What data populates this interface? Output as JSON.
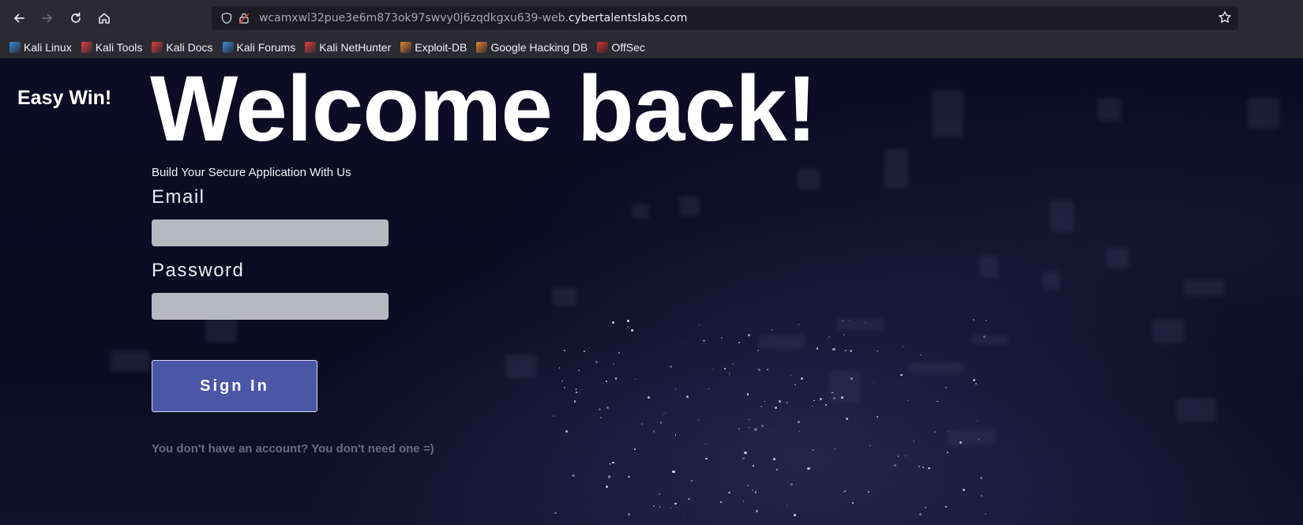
{
  "browser": {
    "url_prefix": "wcamxwl32pue3e6m873ok97swvy0j6zqdkgxu639-web.",
    "url_domain": "cybertalentslabs.com",
    "icons": {
      "back": "back-arrow-icon",
      "forward": "forward-arrow-icon",
      "reload": "reload-icon",
      "home": "home-icon",
      "shield": "tracking-shield-icon",
      "lock": "lock-icon",
      "star": "bookmark-star-icon"
    },
    "bookmarks": [
      {
        "label": "Kali Linux",
        "icon": "kali-dragon-icon",
        "color": "#3b8ed8"
      },
      {
        "label": "Kali Tools",
        "icon": "kali-tools-icon",
        "color": "#e64040"
      },
      {
        "label": "Kali Docs",
        "icon": "kali-docs-icon",
        "color": "#e33b3b"
      },
      {
        "label": "Kali Forums",
        "icon": "kali-forums-icon",
        "color": "#3b8ed8"
      },
      {
        "label": "Kali NetHunter",
        "icon": "kali-nethunter-icon",
        "color": "#e33b3b"
      },
      {
        "label": "Exploit-DB",
        "icon": "exploit-db-icon",
        "color": "#e8852c"
      },
      {
        "label": "Google Hacking DB",
        "icon": "ghdb-icon",
        "color": "#e8852c"
      },
      {
        "label": "OffSec",
        "icon": "offsec-icon",
        "color": "#d42a2a"
      }
    ]
  },
  "page": {
    "brand": "Easy Win!",
    "heading": "Welcome back!",
    "subtitle": "Build Your Secure Application With Us",
    "email_label": "Email",
    "email_value": "",
    "password_label": "Password",
    "password_value": "",
    "signin_label": "Sign In",
    "footer_note": "You don't have an account? You don't need one =)",
    "accent_color": "#4c56a6"
  }
}
